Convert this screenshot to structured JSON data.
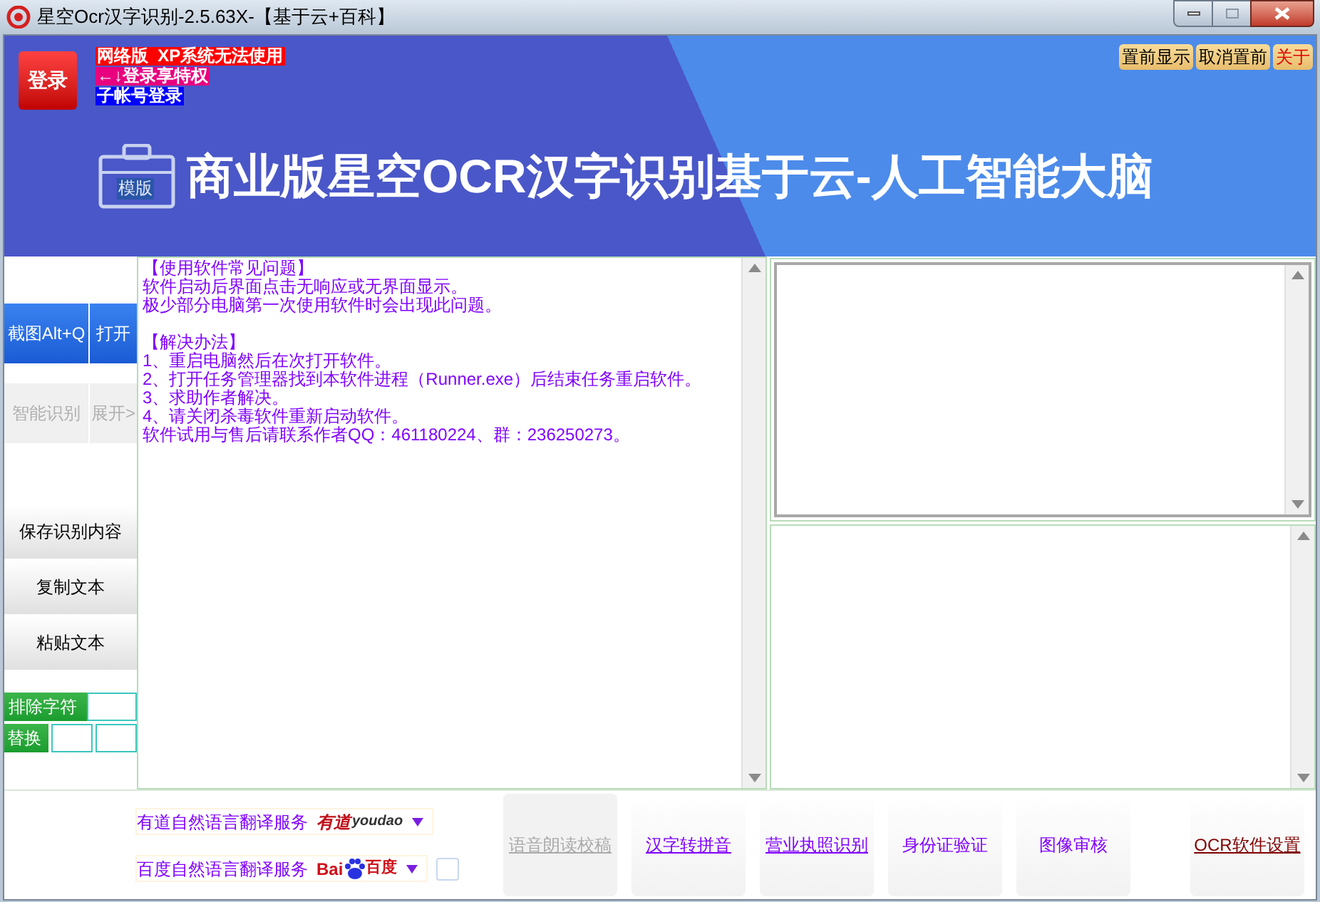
{
  "window": {
    "title": "星空Ocr汉字识别-2.5.63X-【基于云+百科】"
  },
  "header": {
    "login_button": "登录",
    "notices": [
      {
        "text": "网络版  XP系统无法使用",
        "color": "#ff0000"
      },
      {
        "text": "←↓登录享特权",
        "color": "#e8007f"
      },
      {
        "text": "子帐号登录",
        "color": "#0000ff"
      }
    ],
    "top_buttons": [
      {
        "label": "置前显示",
        "kind": "normal"
      },
      {
        "label": "取消置前",
        "kind": "normal"
      },
      {
        "label": "关于",
        "kind": "accent"
      }
    ],
    "badge": "模版",
    "title": "商业版星空OCR汉字识别基于云-人工智能大脑"
  },
  "sidebar": {
    "action_rows": [
      [
        {
          "label": "截图Alt+Q",
          "disabled": false
        },
        {
          "label": "打开",
          "disabled": false
        }
      ],
      [
        {
          "label": "智能识别",
          "disabled": true
        },
        {
          "label": "展开>",
          "disabled": true
        }
      ]
    ],
    "buttons": [
      "保存识别内容",
      "复制文本",
      "粘贴文本"
    ],
    "exclude_label": "排除字符",
    "replace_label": "替换"
  },
  "help_text": [
    {
      "heading": "【使用软件常见问题】",
      "lines": [
        "软件启动后界面点击无响应或无界面显示。",
        "极少部分电脑第一次使用软件时会出现此问题。"
      ]
    },
    {
      "heading": "【解决办法】",
      "lines": [
        "1、重启电脑然后在次打开软件。",
        "2、打开任务管理器找到本软件进程（Runner.exe）后结束任务重启软件。",
        "3、求助作者解决。",
        "4、请关闭杀毒软件重新启动软件。",
        "软件试用与售后请联系作者QQ：461180224、群：236250273。"
      ]
    }
  ],
  "translation_services": [
    {
      "label": "有道自然语言翻译服务",
      "kind": "youdao",
      "logo_parts": [
        "有道",
        "youdao"
      ]
    },
    {
      "label": "百度自然语言翻译服务",
      "kind": "baidu",
      "logo_parts": [
        "Bai",
        "百度"
      ],
      "checked": false
    }
  ],
  "bottom_buttons": [
    {
      "label": "语音朗读校稿",
      "kind": "disabled"
    },
    {
      "label": "汉字转拼音",
      "kind": "link"
    },
    {
      "label": "营业执照识别",
      "kind": "link"
    },
    {
      "label": "身份证验证",
      "kind": "plain"
    },
    {
      "label": "图像审核",
      "kind": "plain"
    },
    {
      "label": "OCR软件设置",
      "kind": "settings"
    }
  ]
}
